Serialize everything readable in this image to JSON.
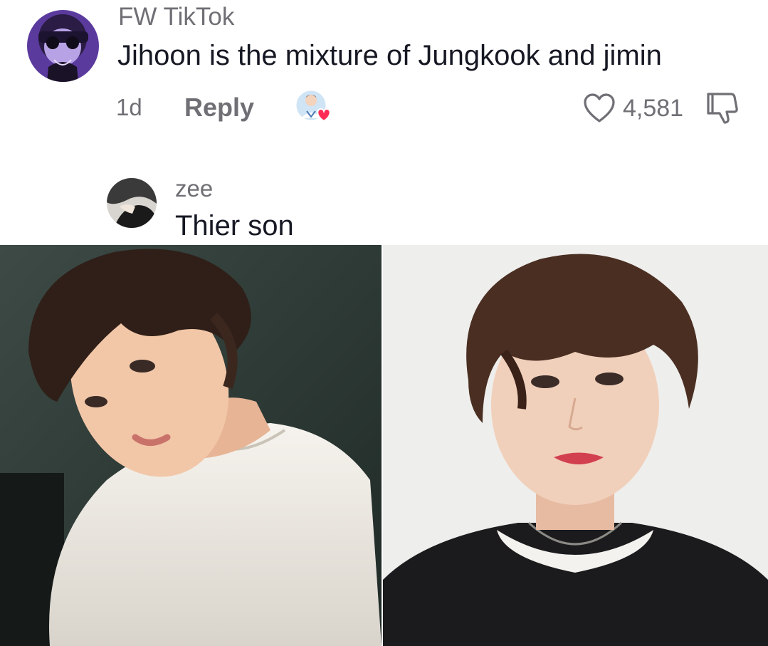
{
  "comment": {
    "username": "FW TikTok",
    "text": "Jihoon is the mixture of Jungkook and jimin",
    "time": "1d",
    "reply_label": "Reply",
    "like_count": "4,581",
    "icons": {
      "avatar": "user-avatar",
      "creator_like": "creator-liked-heart-icon",
      "like": "heart-outline-icon",
      "dislike": "thumbs-down-icon"
    }
  },
  "reply": {
    "username": "zee",
    "text": "Thier son",
    "attachments": [
      "photo-left",
      "photo-right"
    ]
  },
  "colors": {
    "text_primary": "#161823",
    "text_secondary": "#6f6f75",
    "creator_heart": "#fe2c55",
    "avatar_purple": "#7a4fc8"
  }
}
